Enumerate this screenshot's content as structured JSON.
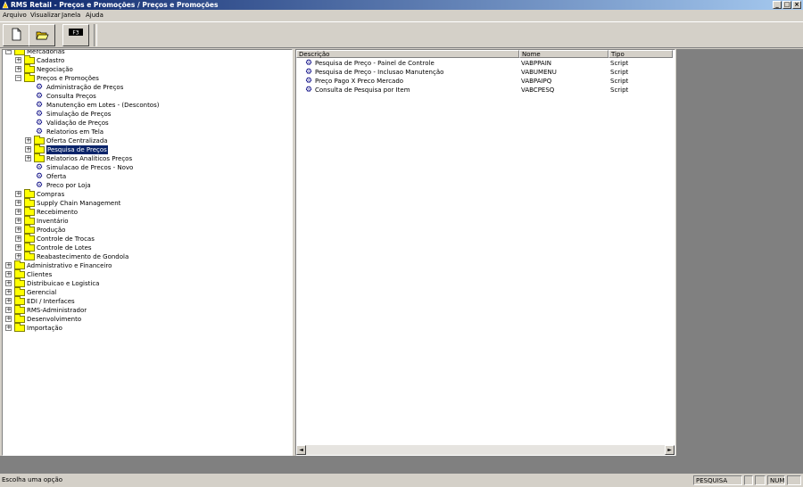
{
  "window": {
    "title": "RMS Retail - Preços e Promoções / Preços e Promoções",
    "minimize": "_",
    "maximize": "□",
    "close": "×"
  },
  "menu": [
    "Arquivo",
    "Visualizar",
    "Janela",
    "Ajuda"
  ],
  "toolbar": {
    "f3_label": "F3"
  },
  "tree": [
    {
      "label": "Mercadorias",
      "type": "folder",
      "level": 0,
      "expander": "−"
    },
    {
      "label": "Cadastro",
      "type": "folder",
      "level": 1,
      "expander": "+"
    },
    {
      "label": "Negociação",
      "type": "folder",
      "level": 1,
      "expander": "+"
    },
    {
      "label": "Preços e Promoções",
      "type": "folder",
      "level": 1,
      "expander": "−"
    },
    {
      "label": "Administração de Preços",
      "type": "program",
      "level": 2
    },
    {
      "label": "Consulta Preços",
      "type": "program",
      "level": 2
    },
    {
      "label": "Manutenção em Lotes - (Descontos)",
      "type": "program",
      "level": 2
    },
    {
      "label": "Simulação de Preços",
      "type": "program",
      "level": 2
    },
    {
      "label": "Validação de Preços",
      "type": "program",
      "level": 2
    },
    {
      "label": "Relatorios em Tela",
      "type": "program",
      "level": 2
    },
    {
      "label": "Oferta Centralizada",
      "type": "folder",
      "level": 2,
      "expander": "+"
    },
    {
      "label": "Pesquisa de Preços",
      "type": "folder",
      "level": 2,
      "expander": "+",
      "selected": true
    },
    {
      "label": "Relatorios Analiticos Preços",
      "type": "folder",
      "level": 2,
      "expander": "+"
    },
    {
      "label": "Simulacao de Precos - Novo",
      "type": "program",
      "level": 2
    },
    {
      "label": "Oferta",
      "type": "program",
      "level": 2
    },
    {
      "label": "Preco por Loja",
      "type": "program",
      "level": 2
    },
    {
      "label": "Compras",
      "type": "folder",
      "level": 1,
      "expander": "+"
    },
    {
      "label": "Supply Chain Management",
      "type": "folder",
      "level": 1,
      "expander": "+"
    },
    {
      "label": "Recebimento",
      "type": "folder",
      "level": 1,
      "expander": "+"
    },
    {
      "label": "Inventário",
      "type": "folder",
      "level": 1,
      "expander": "+"
    },
    {
      "label": "Produção",
      "type": "folder",
      "level": 1,
      "expander": "+"
    },
    {
      "label": "Controle de Trocas",
      "type": "folder",
      "level": 1,
      "expander": "+"
    },
    {
      "label": "Controle de Lotes",
      "type": "folder",
      "level": 1,
      "expander": "+"
    },
    {
      "label": "Reabastecimento de Gondola",
      "type": "folder",
      "level": 1,
      "expander": "+"
    },
    {
      "label": "Administrativo e Financeiro",
      "type": "folder",
      "level": 0,
      "expander": "+"
    },
    {
      "label": "Clientes",
      "type": "folder",
      "level": 0,
      "expander": "+"
    },
    {
      "label": "Distribuicao e Logistica",
      "type": "folder",
      "level": 0,
      "expander": "+"
    },
    {
      "label": "Gerencial",
      "type": "folder",
      "level": 0,
      "expander": "+"
    },
    {
      "label": "EDI / Interfaces",
      "type": "folder",
      "level": 0,
      "expander": "+"
    },
    {
      "label": "RMS-Administrador",
      "type": "folder",
      "level": 0,
      "expander": "+"
    },
    {
      "label": "Desenvolvimento",
      "type": "folder",
      "level": 0,
      "expander": "+"
    },
    {
      "label": "Importação",
      "type": "folder",
      "level": 0,
      "expander": "+"
    }
  ],
  "list": {
    "headers": {
      "descricao": "Descrição",
      "nome": "Nome",
      "tipo": "Tipo"
    },
    "rows": [
      {
        "descricao": "Pesquisa de Preço - Painel de Controle",
        "nome": "VABPPAIN",
        "tipo": "Script"
      },
      {
        "descricao": "Pesquisa de Preço - Inclusao Manutenção",
        "nome": "VABUMENU",
        "tipo": "Script"
      },
      {
        "descricao": "Preço Pago X Preco Mercado",
        "nome": "VABPAIPQ",
        "tipo": "Script"
      },
      {
        "descricao": "Consulta de Pesquisa por Item",
        "nome": "VABCPESQ",
        "tipo": "Script"
      }
    ],
    "scroll_left": "◄",
    "scroll_right": "►"
  },
  "status": {
    "message": "Escolha uma opção",
    "mode": "PESQUISA",
    "num": "NUM"
  }
}
